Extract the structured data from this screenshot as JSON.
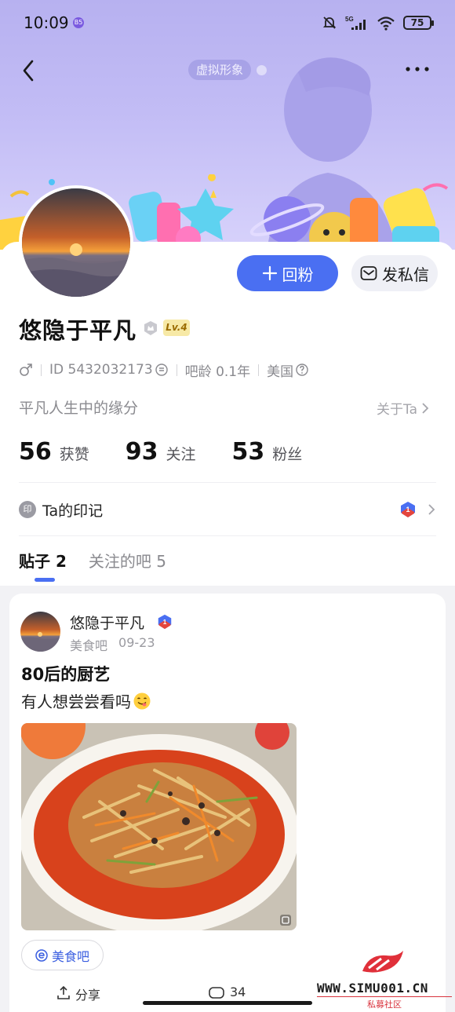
{
  "status_bar": {
    "time": "10:09",
    "network": "5G",
    "battery": "75",
    "app_badge": "B5"
  },
  "header": {
    "virtual_avatar_label": "虚拟形象"
  },
  "profile": {
    "username": "悠隐于平凡",
    "level": "Lv.4",
    "id_text": "ID 5432032173",
    "age_text": "吧龄 0.1年",
    "location": "美国",
    "bio": "平凡人生中的缘分",
    "about_link": "关于Ta"
  },
  "actions": {
    "follow_label": "回粉",
    "message_label": "发私信"
  },
  "stats": [
    {
      "value": "56",
      "label": "获赞"
    },
    {
      "value": "93",
      "label": "关注"
    },
    {
      "value": "53",
      "label": "粉丝"
    }
  ],
  "seal": {
    "icon_text": "印",
    "label": "Ta的印记"
  },
  "tabs": [
    {
      "label": "贴子 2",
      "active": true
    },
    {
      "label": "关注的吧 5",
      "active": false
    }
  ],
  "post": {
    "author": "悠隐于平凡",
    "forum": "美食吧",
    "date": "09-23",
    "title": "80后的厨艺",
    "body": "有人想尝尝看吗",
    "forum_chip": "美食吧",
    "share_label": "分享",
    "comment_count": "34"
  },
  "watermark": {
    "url": "WWW.SIMU001.CN",
    "sub": "私募社区"
  },
  "colors": {
    "accent": "#4a6ff2",
    "banner": "#c2bcf5",
    "level_badge": "#f7e9a6"
  }
}
